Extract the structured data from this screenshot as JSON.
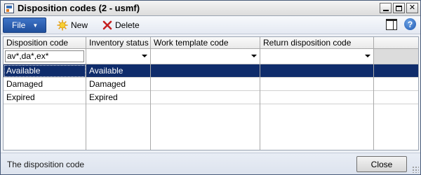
{
  "window": {
    "title": "Disposition codes (2 - usmf)",
    "controls": {
      "minimize": "minimize",
      "maximize": "maximize",
      "close": "✕"
    }
  },
  "toolbar": {
    "file_label": "File",
    "new_label": "New",
    "delete_label": "Delete"
  },
  "grid": {
    "columns": [
      "Disposition code",
      "Inventory status",
      "Work template code",
      "Return disposition code"
    ],
    "filters": {
      "disposition_code": "av*,da*,ex*",
      "inventory_status": "",
      "work_template_code": "",
      "return_disposition_code": ""
    },
    "rows": [
      {
        "disposition_code": "Available",
        "inventory_status": "Available",
        "work_template_code": "",
        "return_disposition_code": ""
      },
      {
        "disposition_code": "Damaged",
        "inventory_status": "Damaged",
        "work_template_code": "",
        "return_disposition_code": ""
      },
      {
        "disposition_code": "Expired",
        "inventory_status": "Expired",
        "work_template_code": "",
        "return_disposition_code": ""
      }
    ],
    "selected_row_index": 0
  },
  "status": {
    "help_text": "The disposition code",
    "close_label": "Close"
  },
  "colors": {
    "selection": "#0f2c6b",
    "file_button": "#2a5db0"
  }
}
